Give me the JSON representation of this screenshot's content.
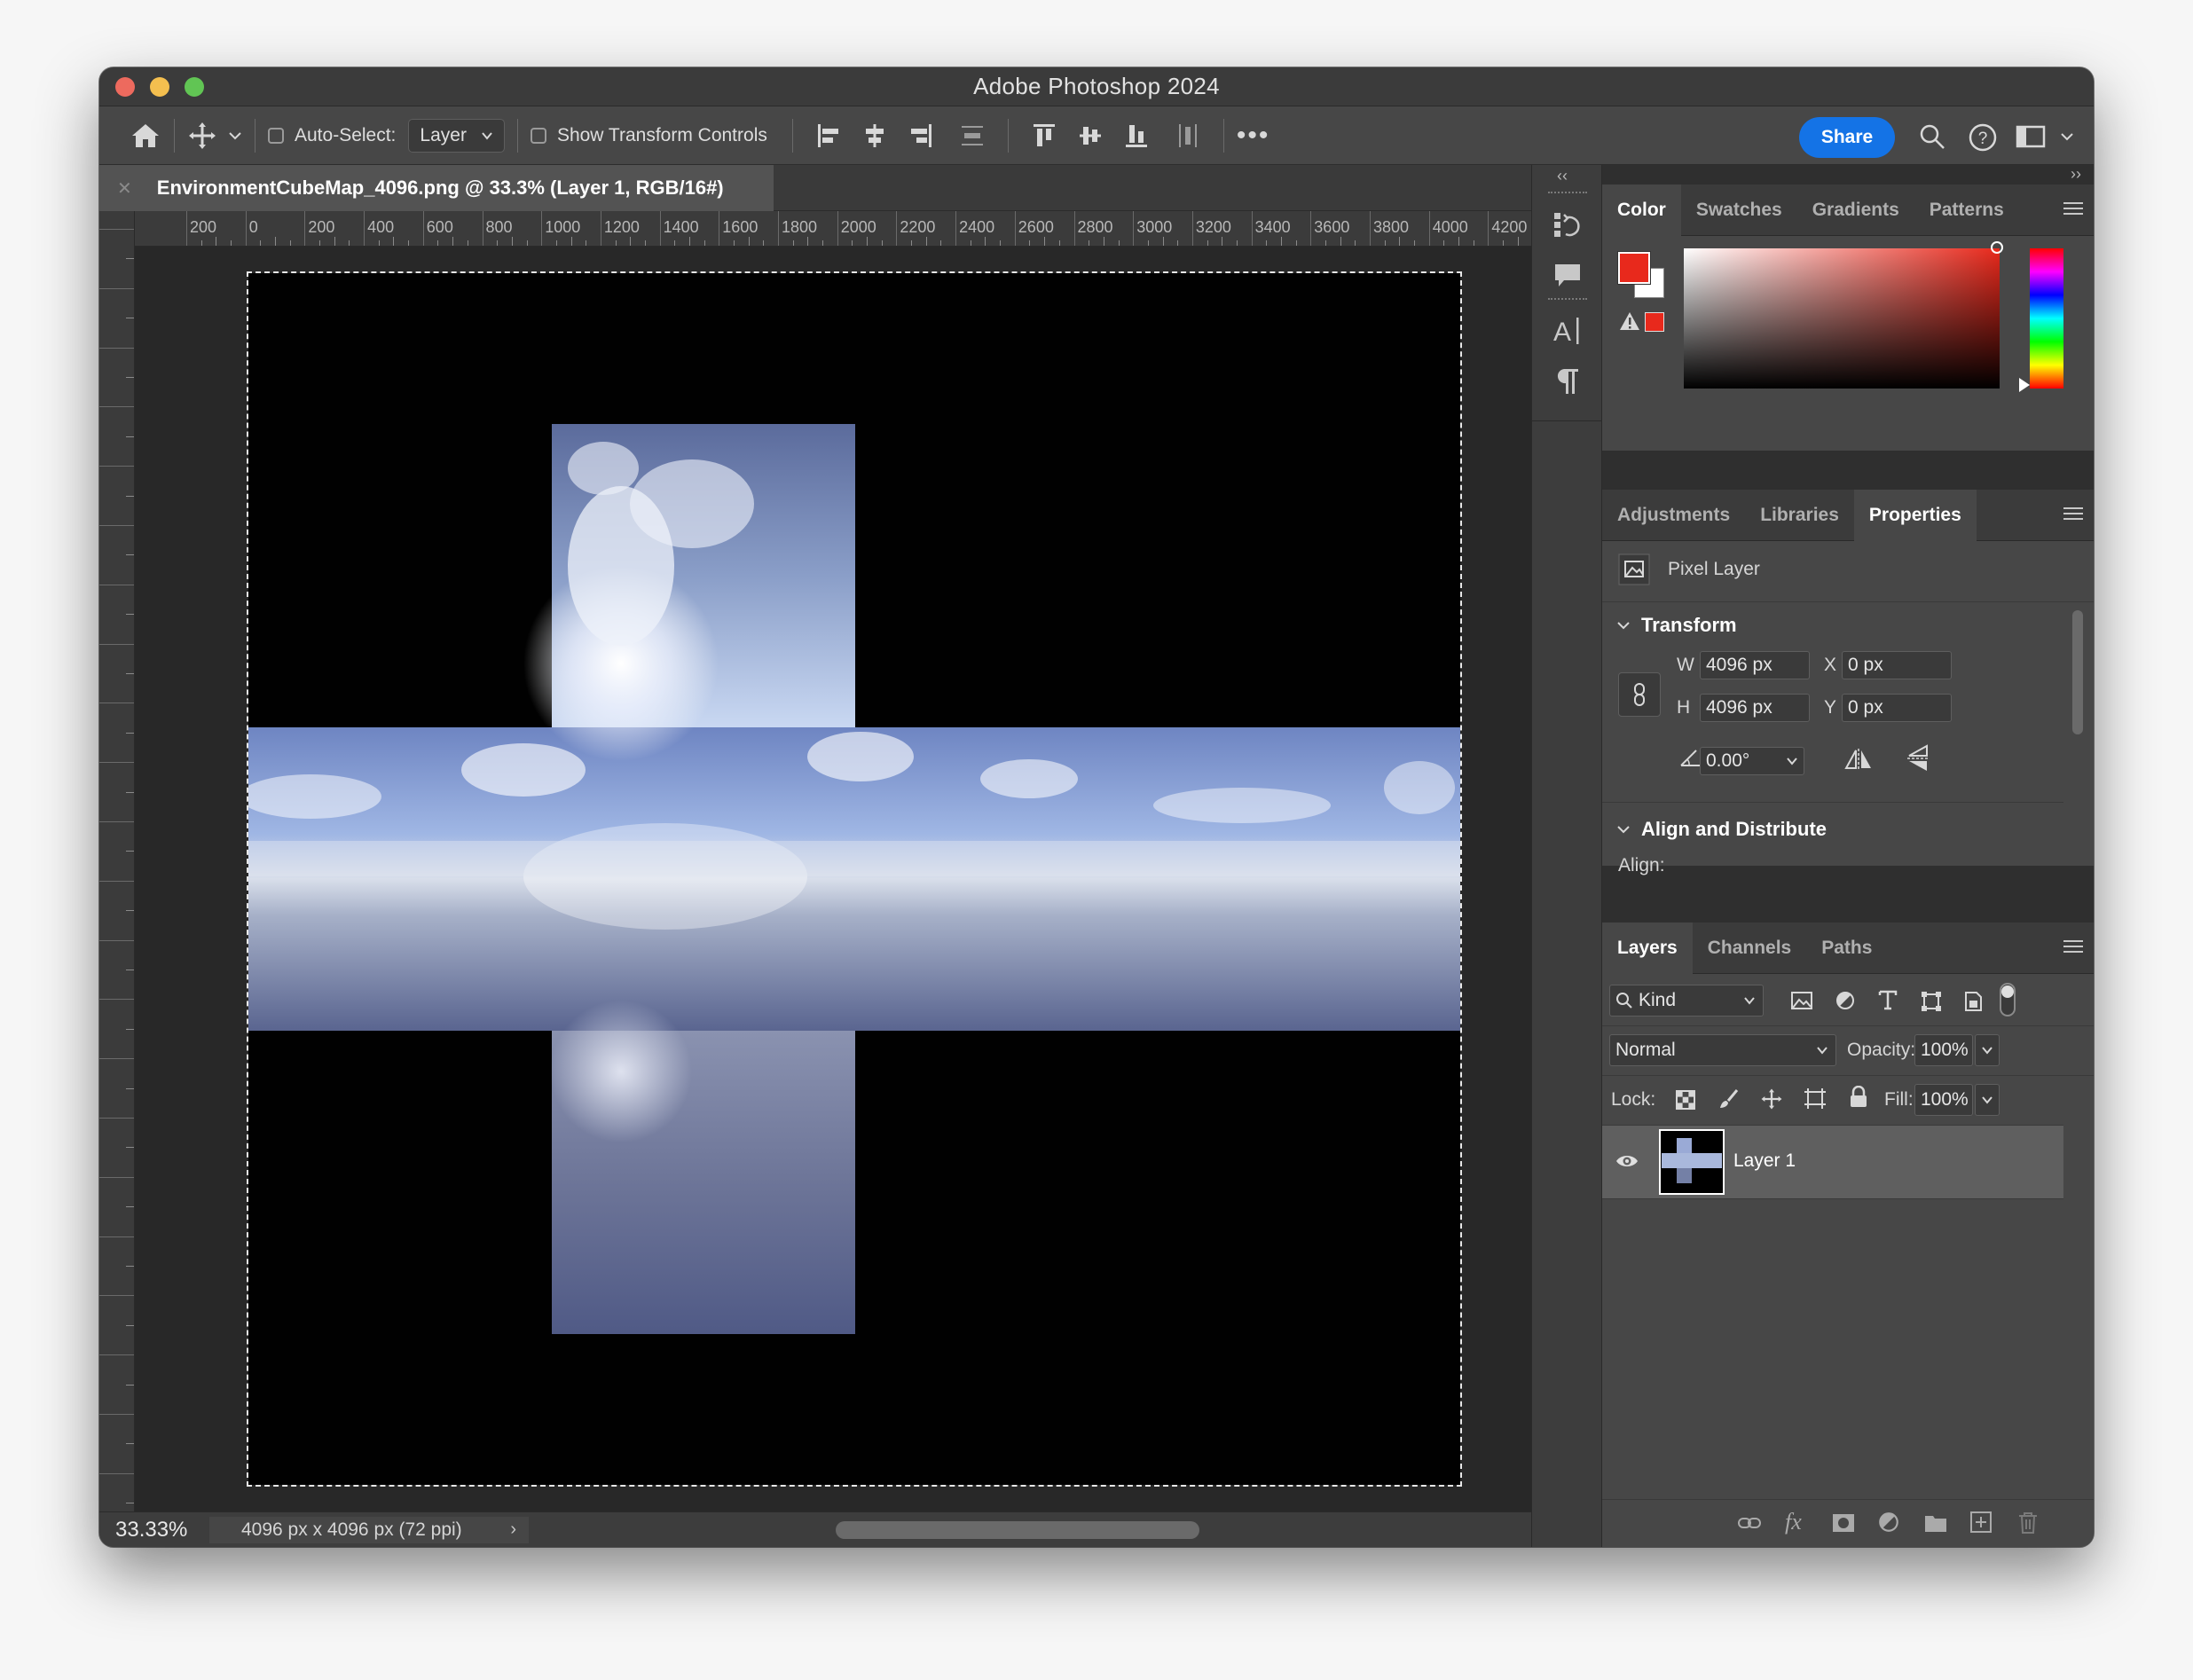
{
  "app": {
    "title": "Adobe Photoshop 2024"
  },
  "options_bar": {
    "auto_select_label": "Auto-Select:",
    "auto_select_value": "Layer",
    "show_transform_label": "Show Transform Controls",
    "share_label": "Share"
  },
  "document": {
    "tab_title": "EnvironmentCubeMap_4096.png @ 33.3% (Layer 1, RGB/16#)",
    "zoom": "33.33%",
    "info": "4096 px x 4096 px (72 ppi)"
  },
  "ruler": {
    "h_labels": [
      "200",
      "0",
      "200",
      "400",
      "600",
      "800",
      "1000",
      "1200",
      "1400",
      "1600",
      "1800",
      "2000",
      "2200",
      "2400",
      "2600",
      "2800",
      "3000",
      "3200",
      "3400",
      "3600",
      "3800",
      "4000",
      "4200"
    ]
  },
  "color_panel": {
    "tabs": [
      "Color",
      "Swatches",
      "Gradients",
      "Patterns"
    ],
    "foreground": "#e8291c",
    "background": "#ffffff"
  },
  "properties_panel": {
    "tabs": [
      "Adjustments",
      "Libraries",
      "Properties"
    ],
    "layer_kind": "Pixel Layer",
    "transform_title": "Transform",
    "w_label": "W",
    "w_value": "4096 px",
    "h_label": "H",
    "h_value": "4096 px",
    "x_label": "X",
    "x_value": "0 px",
    "y_label": "Y",
    "y_value": "0 px",
    "angle_value": "0.00°",
    "align_title": "Align and Distribute",
    "align_label": "Align:"
  },
  "layers_panel": {
    "tabs": [
      "Layers",
      "Channels",
      "Paths"
    ],
    "filter_label": "Kind",
    "blend_mode": "Normal",
    "opacity_label": "Opacity:",
    "opacity_value": "100%",
    "lock_label": "Lock:",
    "fill_label": "Fill:",
    "fill_value": "100%",
    "layers": [
      {
        "name": "Layer 1",
        "visible": true
      }
    ]
  },
  "colors": {
    "accent": "#1473e6",
    "panel_bg": "#474747",
    "canvas_bg": "#282828"
  }
}
